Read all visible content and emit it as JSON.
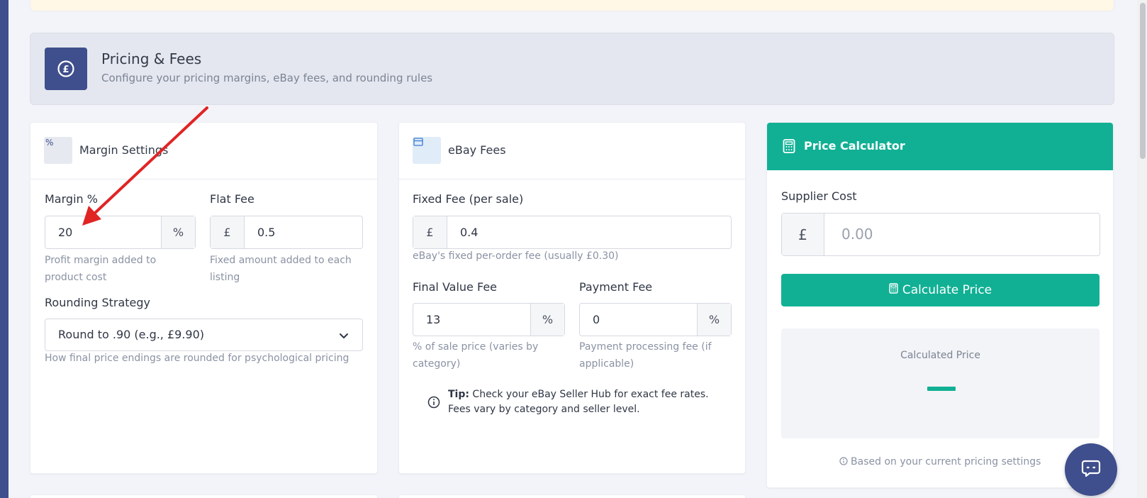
{
  "section": {
    "title": "Pricing & Fees",
    "subtitle": "Configure your pricing margins, eBay fees, and rounding rules",
    "icon": "pound-icon"
  },
  "margin_card": {
    "title": "Margin Settings",
    "icon_glyph": "%",
    "margin_label": "Margin %",
    "margin_value": "20",
    "margin_suffix": "%",
    "margin_help": "Profit margin added to product cost",
    "flat_fee_label": "Flat Fee",
    "flat_fee_prefix": "£",
    "flat_fee_value": "0.5",
    "flat_fee_help": "Fixed amount added to each listing",
    "rounding_label": "Rounding Strategy",
    "rounding_value": "Round to .90 (e.g., £9.90)",
    "rounding_help": "How final price endings are rounded for psychological pricing"
  },
  "fees_card": {
    "title": "eBay Fees",
    "fixed_fee_label": "Fixed Fee (per sale)",
    "fixed_fee_prefix": "£",
    "fixed_fee_value": "0.4",
    "fixed_fee_help": "eBay's fixed per-order fee (usually £0.30)",
    "fvf_label": "Final Value Fee",
    "fvf_value": "13",
    "fvf_suffix": "%",
    "fvf_help": "% of sale price (varies by category)",
    "payment_label": "Payment Fee",
    "payment_value": "0",
    "payment_suffix": "%",
    "payment_help": "Payment processing fee (if applicable)",
    "tip_bold": "Tip:",
    "tip_text": " Check your eBay Seller Hub for exact fee rates. Fees vary by category and seller level."
  },
  "calculator": {
    "title": "Price Calculator",
    "supplier_label": "Supplier Cost",
    "supplier_prefix": "£",
    "supplier_placeholder": "0.00",
    "button_label": "Calculate Price",
    "result_label": "Calculated Price",
    "based_note": "Based on your current pricing settings"
  },
  "colors": {
    "brand": "#3f4e8c",
    "accent": "#11b094",
    "annotation_arrow": "#e02424"
  }
}
